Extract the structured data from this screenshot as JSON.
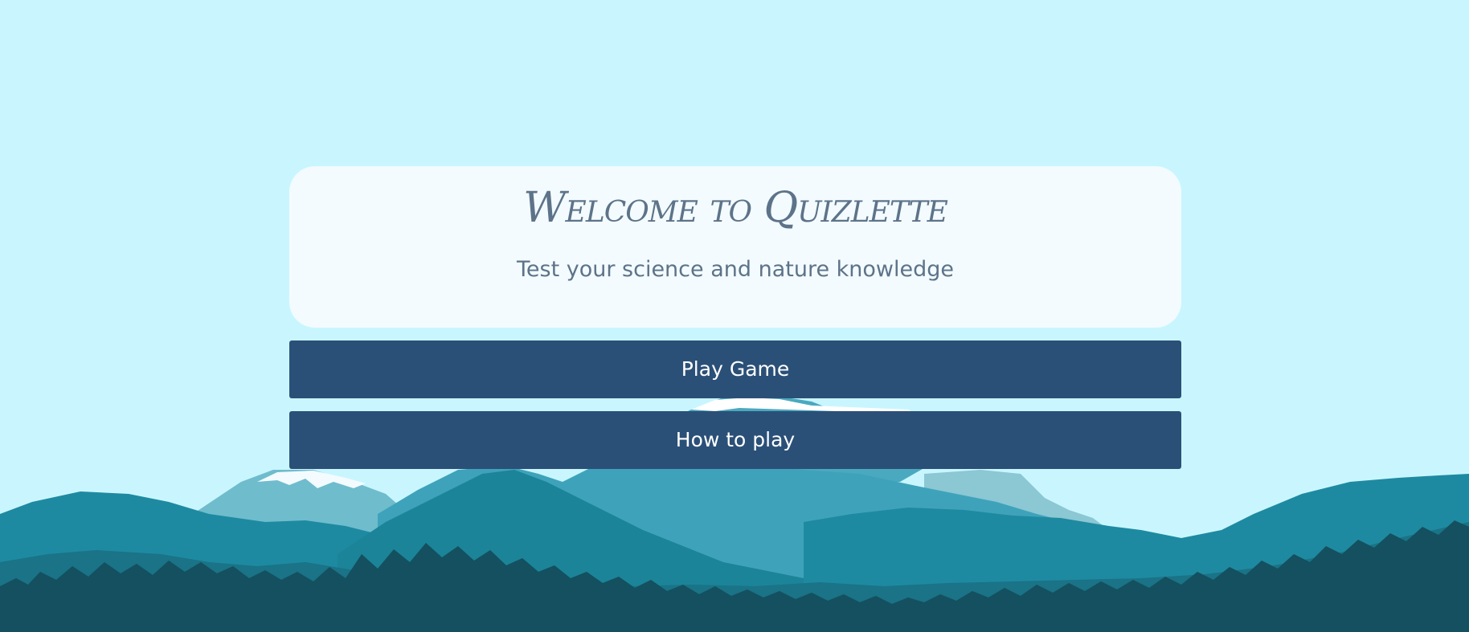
{
  "game": {
    "title": "Welcome to Quizlette",
    "subtitle": "Test your science and nature knowledge"
  },
  "menu": {
    "play_label": "Play Game",
    "how_to_label": "How to play"
  },
  "colors": {
    "sky": "#c9f6fe",
    "card": "#f3fbff",
    "button": "#2b5078",
    "text": "#5d7389"
  }
}
